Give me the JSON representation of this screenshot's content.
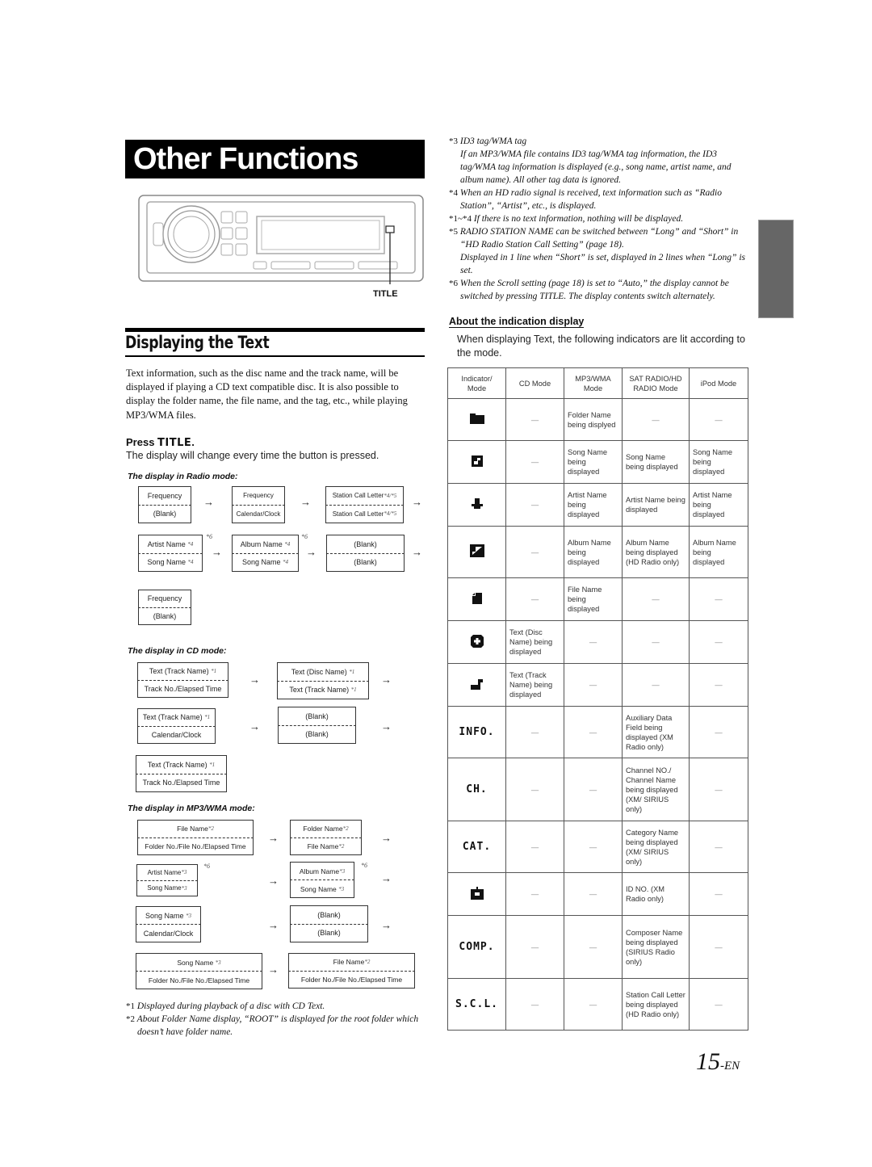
{
  "header": {
    "title": "Other Functions",
    "button_label": "TITLE"
  },
  "section": {
    "heading": "Displaying the Text",
    "intro": "Text information, such as the disc name and the track name, will be displayed if playing a CD text compatible disc. It is also possible to display the folder name, the file name, and the tag, etc., while playing MP3/WMA files.",
    "press_prefix": "Press ",
    "press_button": "TITLE",
    "press_suffix": ".",
    "press_desc": "The display will change every time the button is pressed."
  },
  "radio_mode": {
    "heading": "The display in Radio mode:",
    "boxes": [
      {
        "top": "Frequency",
        "bottom": "(Blank)"
      },
      {
        "top": "Frequency",
        "bottom": "Calendar/Clock"
      },
      {
        "top": "Station Call Letter",
        "top_note": "*4/*5",
        "bottom": "Station Call Letter",
        "bottom_note": "*4/*5"
      },
      {
        "top": "Artist Name",
        "top_note": "*4",
        "bottom": "Song Name",
        "bottom_note": "*4",
        "side_note": "*6"
      },
      {
        "top": "Album Name",
        "top_note": "*4",
        "bottom": "Song Name",
        "bottom_note": "*4",
        "side_note": "*6"
      },
      {
        "top": "(Blank)",
        "bottom": "(Blank)"
      },
      {
        "top": "Frequency",
        "bottom": "(Blank)"
      }
    ]
  },
  "cd_mode": {
    "heading": "The display in CD mode:",
    "boxes": [
      {
        "top": "Text (Track Name)",
        "top_note": "*1",
        "bottom": "Track No./Elapsed Time"
      },
      {
        "top": "Text (Disc Name)",
        "top_note": "*1",
        "bottom": "Text (Track Name)",
        "bottom_note": "*1"
      },
      {
        "top": "Text (Track Name)",
        "top_note": "*1",
        "bottom": "Calendar/Clock"
      },
      {
        "top": "(Blank)",
        "bottom": "(Blank)"
      },
      {
        "top": "Text (Track Name)",
        "top_note": "*1",
        "bottom": "Track No./Elapsed Time"
      }
    ]
  },
  "mp3_mode": {
    "heading": "The display in MP3/WMA mode:",
    "boxes": [
      {
        "top": "File Name",
        "top_note": "*2",
        "bottom": "Folder No./File No./Elapsed Time"
      },
      {
        "top": "Folder Name",
        "top_note": "*2",
        "bottom": "File Name",
        "bottom_note": "*2"
      },
      {
        "top": "Artist Name",
        "top_note": "*3",
        "bottom": "Song Name",
        "bottom_note": "*3",
        "side_note": "*6"
      },
      {
        "top": "Album Name",
        "top_note": "*3",
        "bottom": "Song Name",
        "bottom_note": "*3",
        "side_note": "*6"
      },
      {
        "top": "Song Name",
        "top_note": "*3",
        "bottom": "Calendar/Clock"
      },
      {
        "top": "(Blank)",
        "bottom": "(Blank)"
      },
      {
        "top": "Song Name",
        "top_note": "*3",
        "bottom": "Folder No./File No./Elapsed Time"
      },
      {
        "top": "File Name",
        "top_note": "*2",
        "bottom": "Folder No./File No./Elapsed Time"
      }
    ]
  },
  "arrow": "→",
  "left_footnotes": [
    {
      "mark": "*1",
      "text": "Displayed during playback of a disc with CD Text."
    },
    {
      "mark": "*2",
      "text": "About Folder Name display, “ROOT” is displayed for the root folder which doesn’t have folder name."
    }
  ],
  "right_footnotes": [
    {
      "mark": "*3",
      "lines": [
        "ID3 tag/WMA tag",
        "If an MP3/WMA file contains ID3 tag/WMA tag information, the ID3 tag/WMA tag information is displayed (e.g., song name, artist name, and album name). All other tag data is ignored."
      ]
    },
    {
      "mark": "*4",
      "lines": [
        "When an HD radio signal is received, text information such as “Radio Station”, “Artist”, etc., is displayed."
      ]
    },
    {
      "mark": "*1~*4",
      "lines": [
        "If there is no text information, nothing will be displayed."
      ]
    },
    {
      "mark": "*5",
      "lines": [
        "RADIO STATION NAME can be switched between “Long” and “Short” in “HD Radio Station Call Setting” (page 18).",
        "Displayed in 1 line when “Short” is set, displayed in 2 lines when “Long” is set."
      ]
    },
    {
      "mark": "*6",
      "lines": [
        "When the Scroll setting (page 18) is set to “Auto,” the display cannot be switched by pressing TITLE. The display contents switch alternately."
      ]
    }
  ],
  "about": {
    "heading": "About the indication display",
    "desc": "When displaying Text, the following indicators are lit according to the mode."
  },
  "indicator_table": {
    "headers": [
      "Indicator/ Mode",
      "CD Mode",
      "MP3/WMA Mode",
      "SAT RADIO/HD RADIO Mode",
      "iPod Mode"
    ],
    "rows": [
      {
        "icon": "folder-icon",
        "cd": "—",
        "mp3": "Folder Name being displyed",
        "sat": "—",
        "ipod": "—"
      },
      {
        "icon": "song-icon",
        "cd": "—",
        "mp3": "Song Name being displayed",
        "sat": "Song Name being displayed",
        "ipod": "Song Name being displayed"
      },
      {
        "icon": "artist-icon",
        "cd": "—",
        "mp3": "Artist Name being displayed",
        "sat": "Artist Name being displayed",
        "ipod": "Artist Name being displayed"
      },
      {
        "icon": "album-icon",
        "cd": "—",
        "mp3": "Album Name being displayed",
        "sat": "Album Name being displayed (HD Radio only)",
        "ipod": "Album Name being displayed"
      },
      {
        "icon": "file-icon",
        "cd": "—",
        "mp3": "File Name being displayed",
        "sat": "—",
        "ipod": "—"
      },
      {
        "icon": "disc-icon",
        "cd": "Text (Disc Name) being displayed",
        "mp3": "—",
        "sat": "—",
        "ipod": "—"
      },
      {
        "icon": "track-icon",
        "cd": "Text (Track Name) being displayed",
        "mp3": "—",
        "sat": "—",
        "ipod": "—"
      },
      {
        "icon": "info-indicator",
        "label": "INFO.",
        "cd": "—",
        "mp3": "—",
        "sat": "Auxiliary Data Field being displayed (XM Radio only)",
        "ipod": "—"
      },
      {
        "icon": "ch-indicator",
        "label": "CH.",
        "cd": "—",
        "mp3": "—",
        "sat": "Channel NO./ Channel Name being displayed (XM/ SIRIUS only)",
        "ipod": "—"
      },
      {
        "icon": "cat-indicator",
        "label": "CAT.",
        "cd": "—",
        "mp3": "—",
        "sat": "Category Name being displayed (XM/ SIRIUS only)",
        "ipod": "—"
      },
      {
        "icon": "id-icon",
        "cd": "—",
        "mp3": "—",
        "sat": "ID NO. (XM Radio only)",
        "ipod": "—"
      },
      {
        "icon": "comp-indicator",
        "label": "COMP.",
        "cd": "—",
        "mp3": "—",
        "sat": "Composer Name being displayed (SIRIUS Radio only)",
        "ipod": "—"
      },
      {
        "icon": "scl-indicator",
        "label": "S.C.L.",
        "cd": "—",
        "mp3": "—",
        "sat": "Station Call Letter being displayed (HD Radio only)",
        "ipod": "—"
      }
    ]
  },
  "page_number": {
    "num": "15",
    "suffix": "-EN"
  },
  "colors": {
    "side_tab": "#666666",
    "title_bg": "#000000"
  }
}
